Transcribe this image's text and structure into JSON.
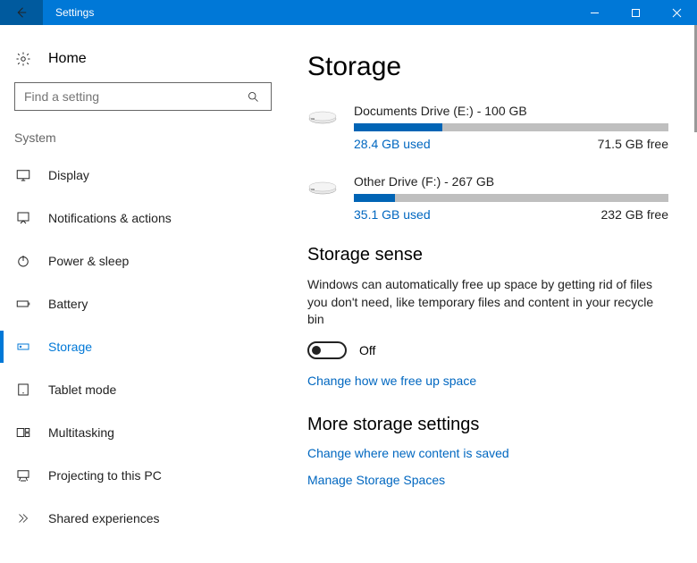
{
  "titlebar": {
    "title": "Settings"
  },
  "sidebar": {
    "home_label": "Home",
    "search_placeholder": "Find a setting",
    "section_label": "System",
    "items": [
      {
        "label": "Display"
      },
      {
        "label": "Notifications & actions"
      },
      {
        "label": "Power & sleep"
      },
      {
        "label": "Battery"
      },
      {
        "label": "Storage"
      },
      {
        "label": "Tablet mode"
      },
      {
        "label": "Multitasking"
      },
      {
        "label": "Projecting to this PC"
      },
      {
        "label": "Shared experiences"
      }
    ]
  },
  "main": {
    "heading": "Storage",
    "drives": [
      {
        "title": "Documents Drive (E:) - 100 GB",
        "used": "28.4 GB used",
        "free": "71.5 GB free",
        "pct": 28
      },
      {
        "title": "Other Drive (F:) - 267 GB",
        "used": "35.1 GB used",
        "free": "232 GB free",
        "pct": 13
      }
    ],
    "sense_heading": "Storage sense",
    "sense_desc": "Windows can automatically free up space by getting rid of files you don't need, like temporary files and content in your recycle bin",
    "toggle_state": "Off",
    "link_change_free": "Change how we free up space",
    "more_heading": "More storage settings",
    "link_change_save": "Change where new content is saved",
    "link_spaces": "Manage Storage Spaces"
  }
}
